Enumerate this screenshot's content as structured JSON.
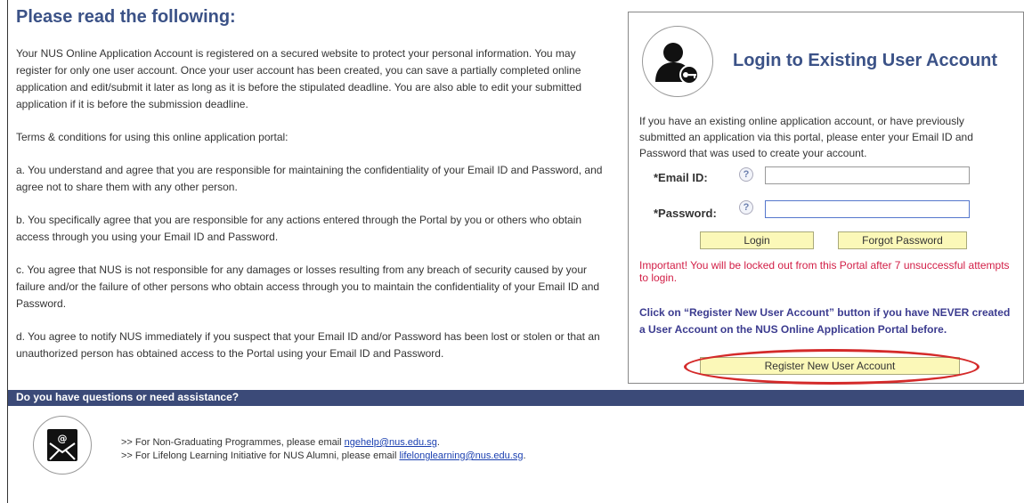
{
  "notice": {
    "title": "Please read the following:",
    "intro": "Your NUS Online Application Account is registered on a secured website to protect your personal information. You may register for only one user account. Once your user account has been created, you can save a partially completed online application and edit/submit it later as long as it is before the stipulated deadline. You are also able to edit your submitted application if it is before the submission deadline.",
    "terms_heading": "Terms & conditions for using this online application portal:",
    "terms": [
      "a. You understand and agree that you are responsible for maintaining the confidentiality of your Email ID and Password, and agree not to share them with any other person.",
      "b. You specifically agree that you are responsible for any actions entered through the Portal by you or others who obtain access through you using your Email ID and Password.",
      "c. You agree that NUS is not responsible for any damages or losses resulting from any breach of security caused by your failure and/or the failure of other persons who obtain access through you to maintain the confidentiality of your Email ID and Password.",
      "d. You agree to notify NUS immediately if you suspect that your Email ID and/or Password has been lost or stolen or that an unauthorized person has obtained access to the Portal using your Email ID and Password."
    ]
  },
  "login": {
    "title": "Login to Existing User Account",
    "intro": "If you have an existing online application account, or have previously submitted an application via this portal, please enter your Email ID and Password that was used to create your account.",
    "email_label": "*Email ID:",
    "password_label": "*Password:",
    "help_glyph": "?",
    "login_button": "Login",
    "forgot_button": "Forgot Password",
    "warning": "Important! You will be locked out from this Portal after 7 unsuccessful attempts to login.",
    "register_note": "Click on “Register New User Account” button if you have NEVER created a User Account on the NUS Online Application Portal before.",
    "register_button": "Register New User Account",
    "accent_color": "#3b5287",
    "warning_color": "#d21e46",
    "button_color": "#fbf8b8"
  },
  "help": {
    "bar_title": "Do you have questions or need assistance?",
    "line1_prefix": ">> For Non-Graduating Programmes, please email ",
    "line1_email": "ngehelp@nus.edu.sg",
    "line1_suffix": ".",
    "line2_prefix": ">> For Lifelong Learning Initiative for NUS Alumni, please email ",
    "line2_email": "lifelonglearning@nus.edu.sg",
    "line2_suffix": ".",
    "bar_color": "#3b4a78"
  }
}
